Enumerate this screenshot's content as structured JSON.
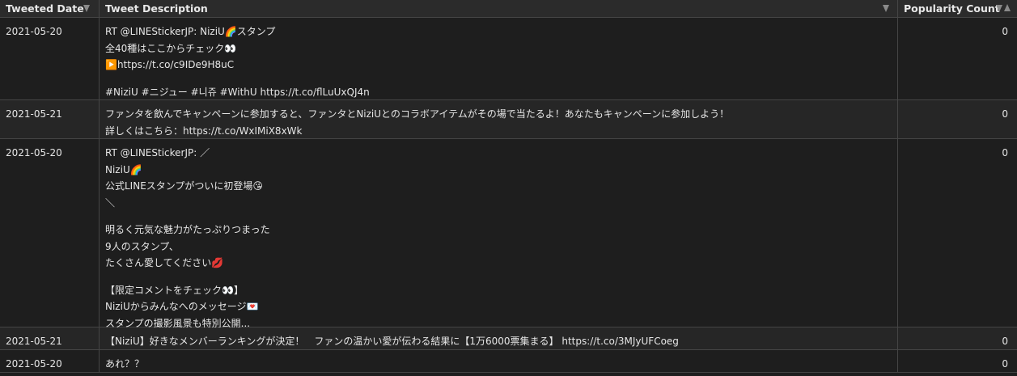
{
  "columns": [
    {
      "label": "Tweeted Date"
    },
    {
      "label": "Tweet Description"
    },
    {
      "label": "Popularity Count"
    }
  ],
  "rows": [
    {
      "date": "2021-05-20",
      "description_lines": [
        "RT @LINEStickerJP: NiziU🌈スタンプ",
        "全40種はここからチェック👀",
        "▶️https://t.co/c9IDe9H8uC",
        "",
        "#NiziU #ニジュー #니쥬 #WithU https://t.co/flLuUxQJ4n"
      ],
      "count": "0"
    },
    {
      "date": "2021-05-21",
      "description_lines": [
        "ファンタを飲んでキャンペーンに参加すると、ファンタとNiziUとのコラボアイテムがその場で当たるよ！あなたもキャンペーンに参加しよう！",
        "詳しくはこちら：https://t.co/WxIMiX8xWk"
      ],
      "count": "0"
    },
    {
      "date": "2021-05-20",
      "description_lines": [
        "RT @LINEStickerJP: ／",
        "NiziU🌈",
        "公式LINEスタンプがついに初登場😘",
        "＼",
        "",
        "明るく元気な魅力がたっぷりつまった",
        "9人のスタンプ、",
        "たくさん愛してください💋",
        "",
        "【限定コメントをチェック👀】",
        "NiziUからみんなへのメッセージ💌",
        "スタンプの撮影風景も特別公開..."
      ],
      "count": "0"
    },
    {
      "date": "2021-05-21",
      "description_lines": [
        "【NiziU】好きなメンバーランキングが決定！　ファンの温かい愛が伝わる結果に【1万6000票集まる】 https://t.co/3MJyUFCoeg"
      ],
      "count": "0"
    },
    {
      "date": "2021-05-20",
      "description_lines": [
        "あれ？？"
      ],
      "count": "0"
    }
  ]
}
